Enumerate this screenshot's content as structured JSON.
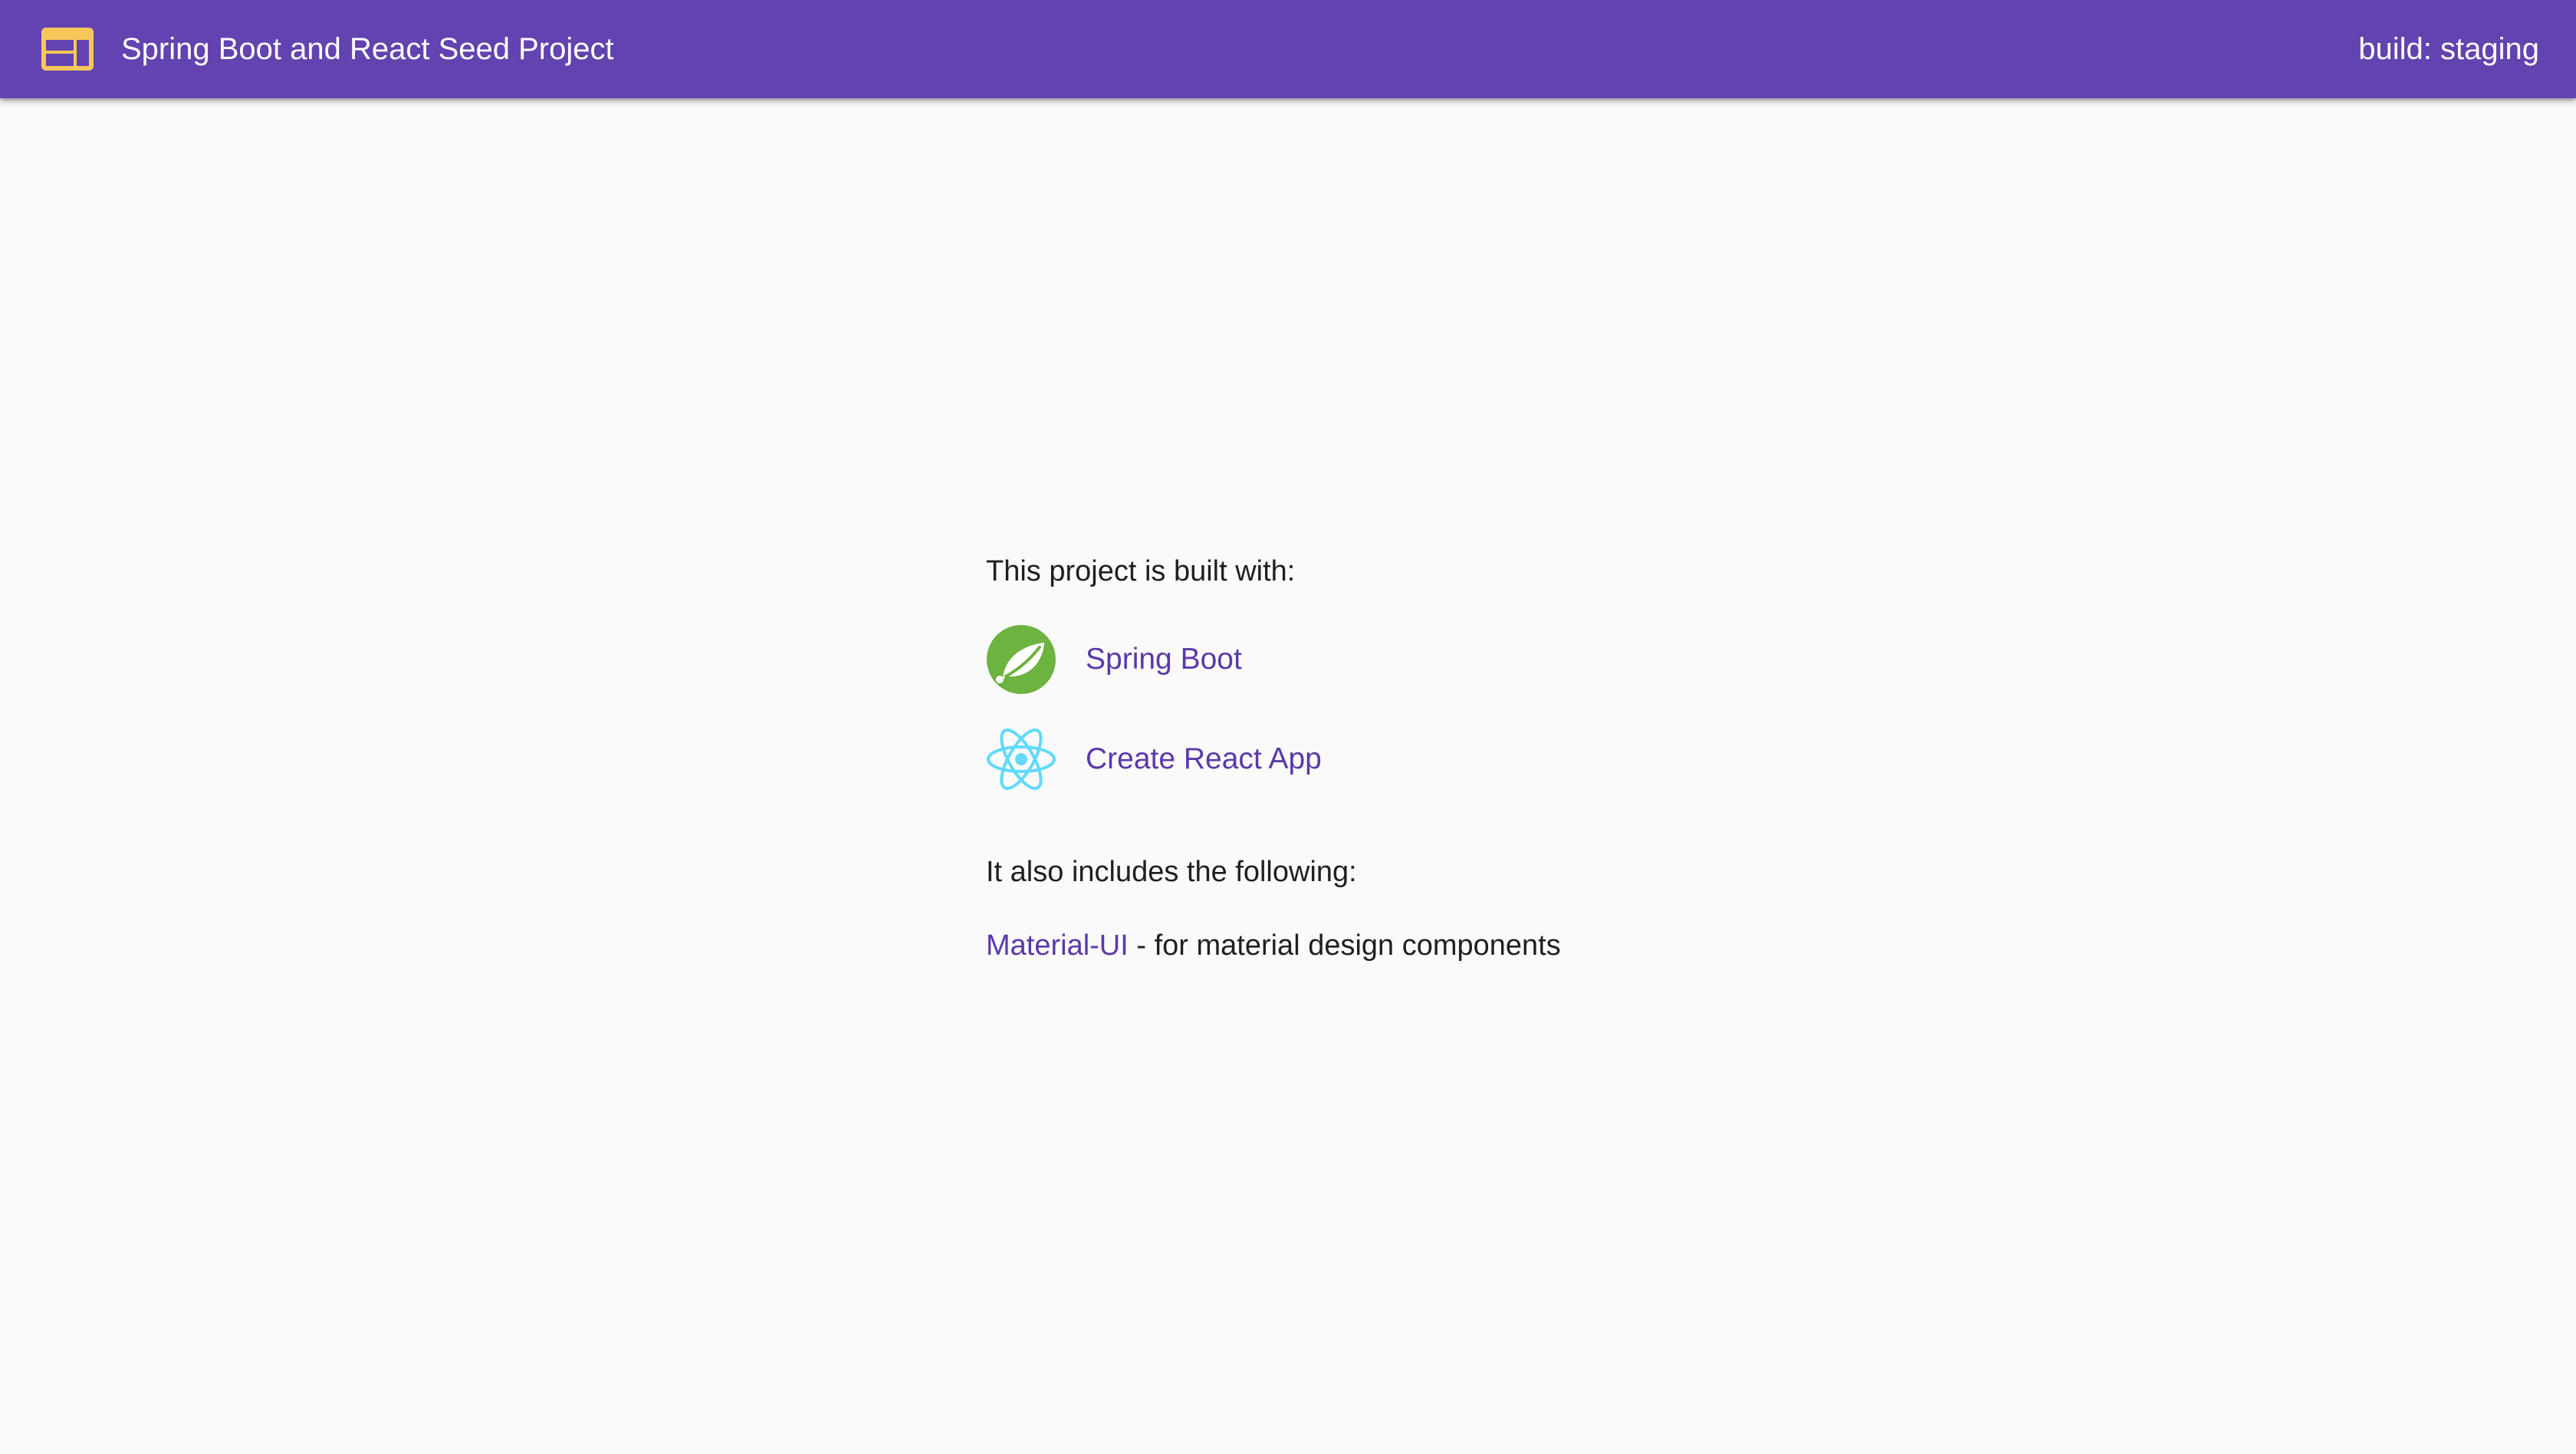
{
  "header": {
    "title": "Spring Boot and React Seed Project",
    "build_label": "build: staging",
    "icon": "web-layout-icon",
    "background_color": "#6243b0",
    "icon_color": "#f6c85a"
  },
  "main": {
    "intro": "This project is built with:",
    "technologies": [
      {
        "label": "Spring Boot",
        "icon": "spring-boot-logo-icon",
        "color": "#6db33f"
      },
      {
        "label": "Create React App",
        "icon": "react-logo-icon",
        "color": "#61dafb"
      }
    ],
    "also_includes": "It also includes the following:",
    "extras": [
      {
        "link_label": "Material-UI",
        "description": " - for material design components"
      }
    ],
    "link_color": "#5b39a8"
  }
}
